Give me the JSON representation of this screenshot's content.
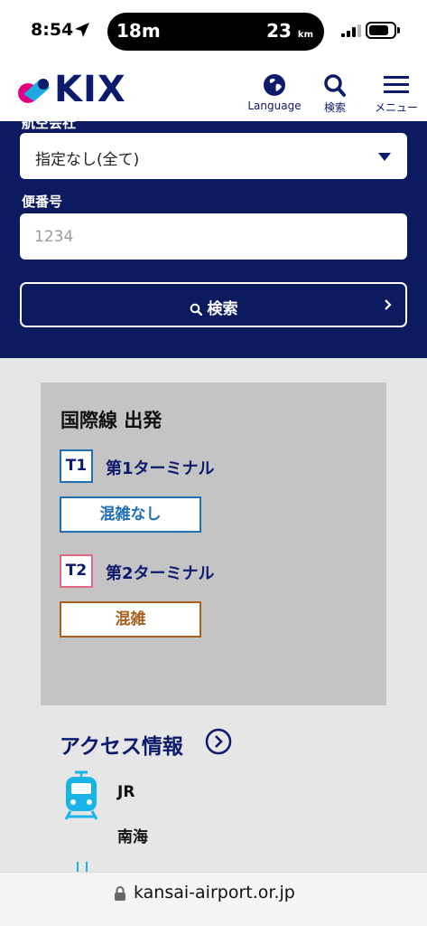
{
  "status_bar": {
    "time": "8:54",
    "island_left": "18m",
    "island_right_value": "23",
    "island_right_unit": "km",
    "battery_level": 0.8
  },
  "header": {
    "logo_text": "KIX",
    "language_label": "Language",
    "search_label": "検索",
    "menu_label": "メニュー"
  },
  "search_panel": {
    "airline_label_partial": "航空会社",
    "airline_select_value": "指定なし(全て)",
    "flight_label": "便番号",
    "flight_placeholder": "1234",
    "search_button_label": "検索"
  },
  "congestion": {
    "title": "国際線 出発",
    "terminals": [
      {
        "badge": "T1",
        "name": "第1ターミナル",
        "status": "混雑なし"
      },
      {
        "badge": "T2",
        "name": "第2ターミナル",
        "status": "混雑"
      }
    ]
  },
  "access": {
    "title": "アクセス情報",
    "items": [
      {
        "label": "JR"
      },
      {
        "label": "南海"
      }
    ]
  },
  "url_bar": {
    "domain": "kansai-airport.or.jp"
  },
  "colors": {
    "navy": "#0c1b60",
    "t1_blue": "#1e6fb4",
    "t2_pink": "#e06a86",
    "congested_brown": "#a6611c",
    "access_cyan": "#18b4e8",
    "logo_pink": "#e5007f"
  }
}
